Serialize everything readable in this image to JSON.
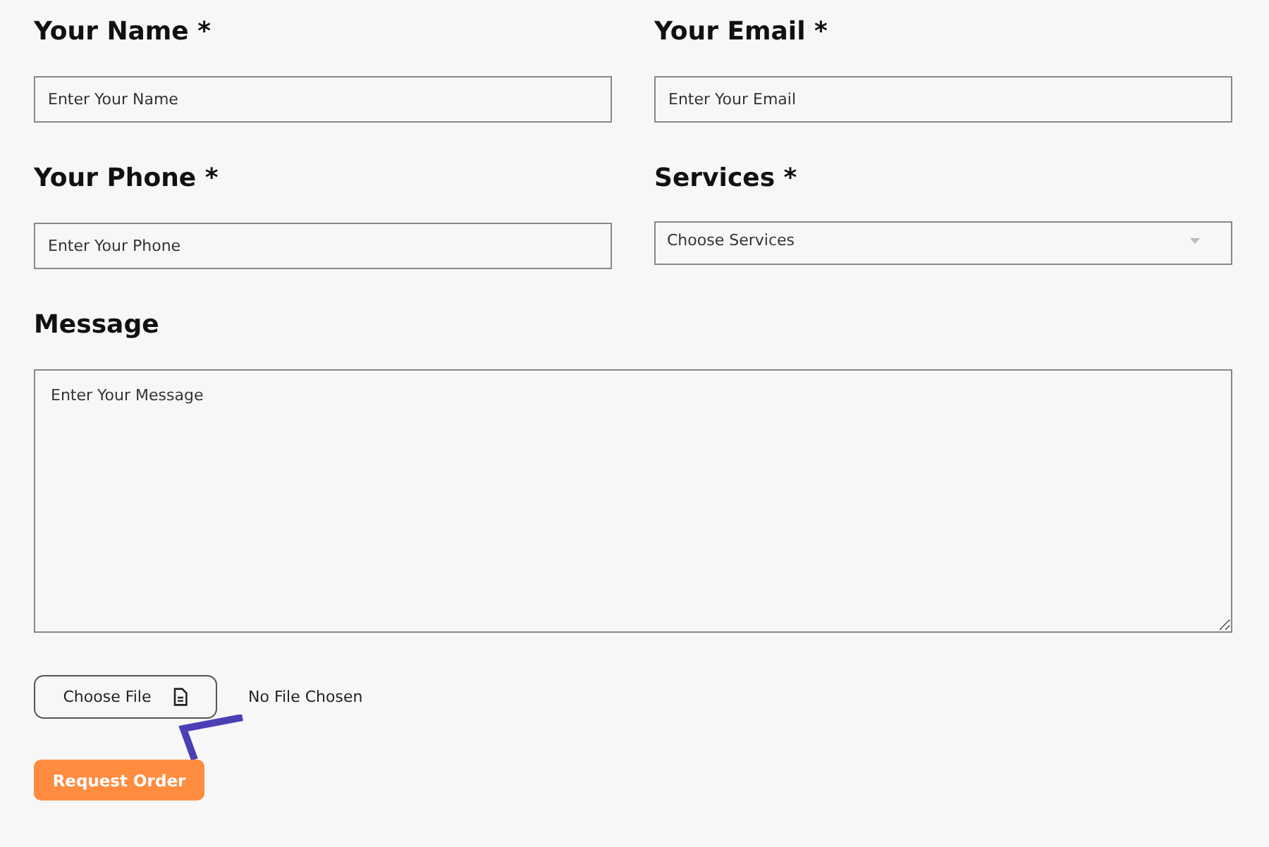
{
  "fields": [
    {
      "kind": "input",
      "label": "Your Name *",
      "placeholder": "Enter Your Name"
    },
    {
      "kind": "input",
      "label": "Your Email *",
      "placeholder": "Enter Your Email"
    },
    {
      "kind": "input",
      "label": "Your Phone *",
      "placeholder": "Enter Your Phone"
    },
    {
      "kind": "select",
      "label": "Services *",
      "placeholder": "Choose Services"
    }
  ],
  "message": {
    "label": "Message",
    "placeholder": "Enter Your Message"
  },
  "file": {
    "button": "Choose File",
    "status": "No File Chosen"
  },
  "submit": "Request Order"
}
